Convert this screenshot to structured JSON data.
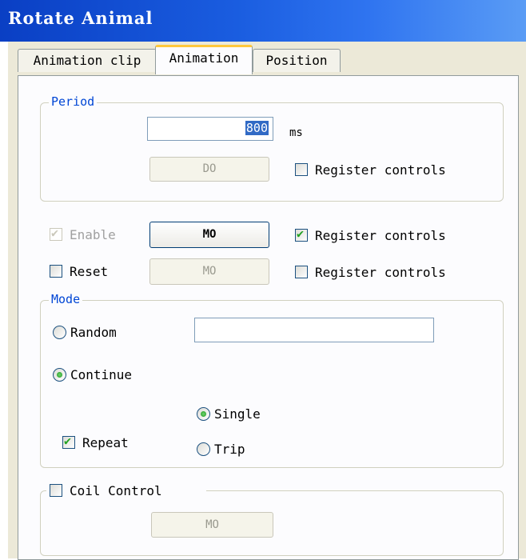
{
  "window": {
    "title": "Rotate Animal"
  },
  "tabs": [
    {
      "label": "Animation clip",
      "active": false
    },
    {
      "label": "Animation",
      "active": true
    },
    {
      "label": "Position",
      "active": false
    }
  ],
  "period": {
    "legend": "Period",
    "value": "800",
    "unit": "ms",
    "button_label": "DO",
    "register_label": "Register controls",
    "register_checked": false
  },
  "enable": {
    "label": "Enable",
    "checked": true,
    "disabled": true,
    "button_label": "MO",
    "register_label": "Register controls",
    "register_checked": true
  },
  "reset": {
    "label": "Reset",
    "checked": false,
    "button_label": "MO",
    "register_label": "Register controls",
    "register_checked": false
  },
  "mode": {
    "legend": "Mode",
    "random_label": "Random",
    "random_value": "",
    "continue_label": "Continue",
    "selected": "Continue",
    "repeat_label": "Repeat",
    "repeat_checked": true,
    "single_label": "Single",
    "trip_label": "Trip",
    "repeat_mode": "Single"
  },
  "coil": {
    "label": "Coil Control",
    "checked": false,
    "button_label": "MO"
  },
  "colors": {
    "title_bar": "#0a3fc4",
    "legend_text": "#0046d5",
    "check_green": "#21a121",
    "active_tab_accent": "#ffc83c"
  }
}
